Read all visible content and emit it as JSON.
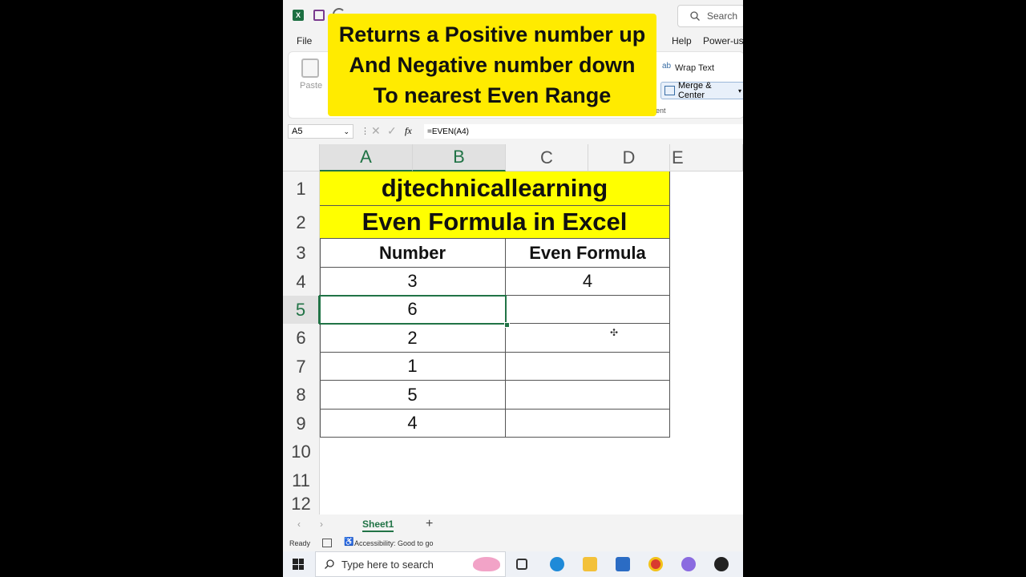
{
  "overlay": {
    "line1": "Returns a Positive number up",
    "line2": "And Negative number down",
    "line3": "To nearest Even Range"
  },
  "titlebar": {
    "search_label": "Search"
  },
  "tabs": {
    "file": "File",
    "help": "Help",
    "power": "Power-use"
  },
  "ribbon": {
    "paste": "Paste",
    "wrap_text": "Wrap Text",
    "merge_center": "Merge & Center",
    "group_alignment_fragment": "ent"
  },
  "formula_bar": {
    "name_box": "A5",
    "fx": "fx",
    "formula": "=EVEN(A4)"
  },
  "columns": [
    "A",
    "B",
    "C",
    "D",
    "E"
  ],
  "rows": [
    "1",
    "2",
    "3",
    "4",
    "5",
    "6",
    "7",
    "8",
    "9",
    "10",
    "11",
    "12"
  ],
  "sheet": {
    "title1": "djtechnicallearning",
    "title2": "Even Formula in Excel",
    "header_number": "Number",
    "header_even": "Even Formula",
    "numbers": [
      "3",
      "6",
      "2",
      "1",
      "5",
      "4"
    ],
    "even_results": [
      "4",
      "",
      "",
      "",
      "",
      ""
    ]
  },
  "sheet_tabs": {
    "active": "Sheet1",
    "add": "+"
  },
  "status": {
    "ready": "Ready",
    "accessibility": "Accessibility: Good to go"
  },
  "taskbar": {
    "search_placeholder": "Type here to search"
  },
  "colors": {
    "excel_green": "#217346",
    "highlight_yellow": "#ffff00",
    "overlay_yellow": "#ffeb00"
  }
}
